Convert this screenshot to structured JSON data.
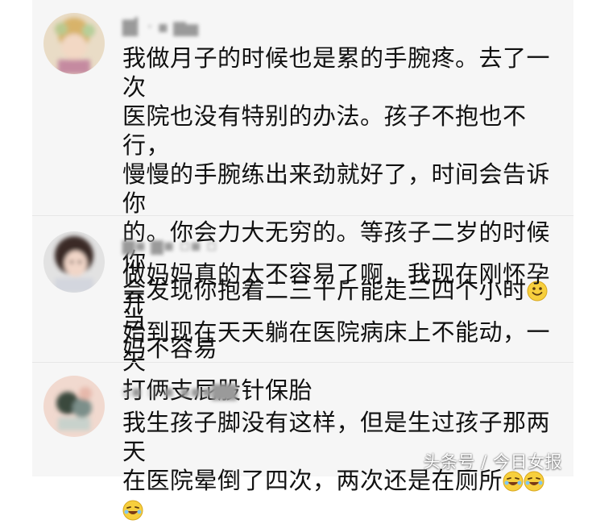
{
  "colors": {
    "panel_bg": "#f6f6f6",
    "text": "#111111",
    "username": "#9a9a9a"
  },
  "comments": [
    {
      "username": "▇▎· ▪ ▆▅",
      "avatar_icon": "blurred-avatar-icon",
      "text_lines": [
        "我做月子的时候也是累的手腕疼。去了一次",
        "医院也没有特别的办法。孩子不抱也不行，",
        "慢慢的手腕练出来劲就好了，时间会告诉你",
        "的。你会力大无穷的。等孩子二岁的时候你",
        "会发现你抱着二三十斤能走三四个小时"
      ],
      "line_5_suffix": "当",
      "line_6": "妈不容易",
      "emoji": "smile-emoji-icon"
    },
    {
      "username": "▆▪ ▆▪ ▫▪ ▫",
      "avatar_icon": "blurred-avatar-icon",
      "text_lines": [
        "做妈妈真的太不容易了啊，我现在刚怀孕开",
        "始到现在天天躺在医院病床上不能动，一天",
        "打俩支屁股针保胎"
      ]
    },
    {
      "username": "ᥲ▪ ▫ ▪ ▪▪▪▇▇",
      "avatar_icon": "blurred-avatar-icon",
      "text_lines": [
        "我生孩子脚没有这样，但是生过孩子那两天",
        "在医院晕倒了四次，两次还是在厕所"
      ],
      "emoji": "laughing-tears-emoji-icon"
    }
  ],
  "watermark": "头条号 / 今日女报"
}
